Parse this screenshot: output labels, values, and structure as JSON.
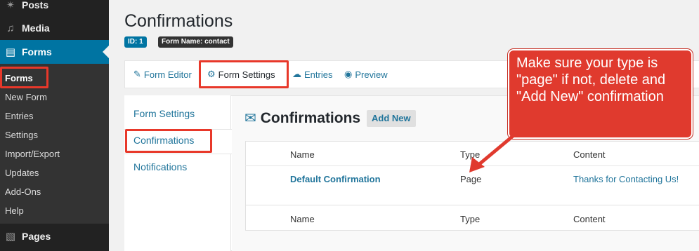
{
  "sidebar": {
    "menu": [
      {
        "label": "Posts",
        "icon": "pin-icon"
      },
      {
        "label": "Media",
        "icon": "media-icon"
      },
      {
        "label": "Forms",
        "icon": "forms-icon"
      },
      {
        "label": "Pages",
        "icon": "pages-icon"
      }
    ],
    "submenu": [
      "Forms",
      "New Form",
      "Entries",
      "Settings",
      "Import/Export",
      "Updates",
      "Add-Ons",
      "Help"
    ]
  },
  "header": {
    "title": "Confirmations",
    "badge_id": "ID: 1",
    "badge_form_name": "Form Name: contact"
  },
  "toolbar": {
    "items": [
      "Form Editor",
      "Form Settings",
      "Entries",
      "Preview"
    ]
  },
  "subnav": {
    "items": [
      "Form Settings",
      "Confirmations",
      "Notifications"
    ]
  },
  "section": {
    "title": "Confirmations",
    "add_new": "Add New"
  },
  "table": {
    "headers": [
      "Name",
      "Type",
      "Content"
    ],
    "rows": [
      {
        "name": "Default Confirmation",
        "type": "Page",
        "content": "Thanks for Contacting Us!"
      }
    ],
    "footers": [
      "Name",
      "Type",
      "Content"
    ]
  },
  "callout": {
    "text": "Make sure your type is \"page\" if not, delete and \"Add New\" confirmation"
  },
  "colors": {
    "accent": "#0074a2",
    "link": "#21759b",
    "highlight": "#e8382a",
    "callout": "#e03a2e"
  }
}
